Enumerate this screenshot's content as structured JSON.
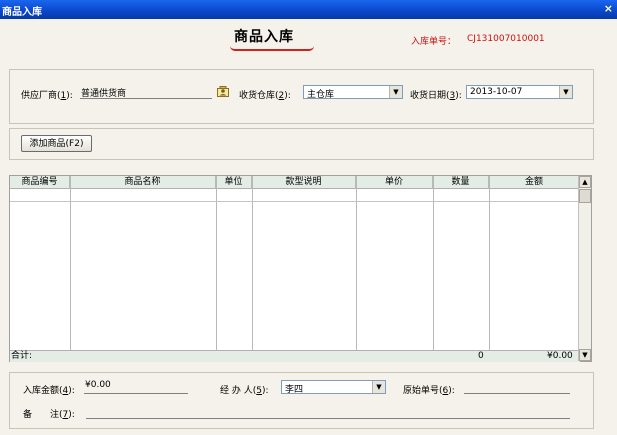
{
  "window": {
    "title": "商品入库",
    "close": "×"
  },
  "header": {
    "title": "商品入库",
    "order_no_label": "入库单号：",
    "order_no": "CJ131007010001"
  },
  "form": {
    "supplier_label": "供应厂商",
    "supplier_key": "1",
    "supplier_value": "普通供货商",
    "warehouse_label": "收货仓库",
    "warehouse_key": "2",
    "warehouse_value": "主仓库",
    "date_label": "收货日期",
    "date_key": "3",
    "date_value": "2013-10-07"
  },
  "toolbar": {
    "add_button": "添加商品(F2)"
  },
  "table": {
    "columns": [
      "商品编号",
      "商品名称",
      "单位",
      "款型说明",
      "单价",
      "数量",
      "金额"
    ],
    "rows": [],
    "total_label": "合计:",
    "total_qty": "0",
    "total_amount": "¥0.00"
  },
  "footer": {
    "amount_label": "入库金额",
    "amount_key": "4",
    "amount_value": "¥0.00",
    "handler_label": "经 办 人",
    "handler_key": "5",
    "handler_value": "李四",
    "orig_label": "原始单号",
    "orig_key": "6",
    "orig_value": "",
    "note_label": "备　　注",
    "note_key": "7",
    "note_value": ""
  },
  "colors": {
    "title_bar": "#0a46c8",
    "accent_red": "#d01010",
    "grid_header": "#e3ede6",
    "window_bg": "#f4f2ea"
  },
  "icons": [
    "close-icon",
    "contact-card-icon",
    "chevron-down-icon",
    "scroll-up-icon",
    "scroll-down-icon"
  ]
}
